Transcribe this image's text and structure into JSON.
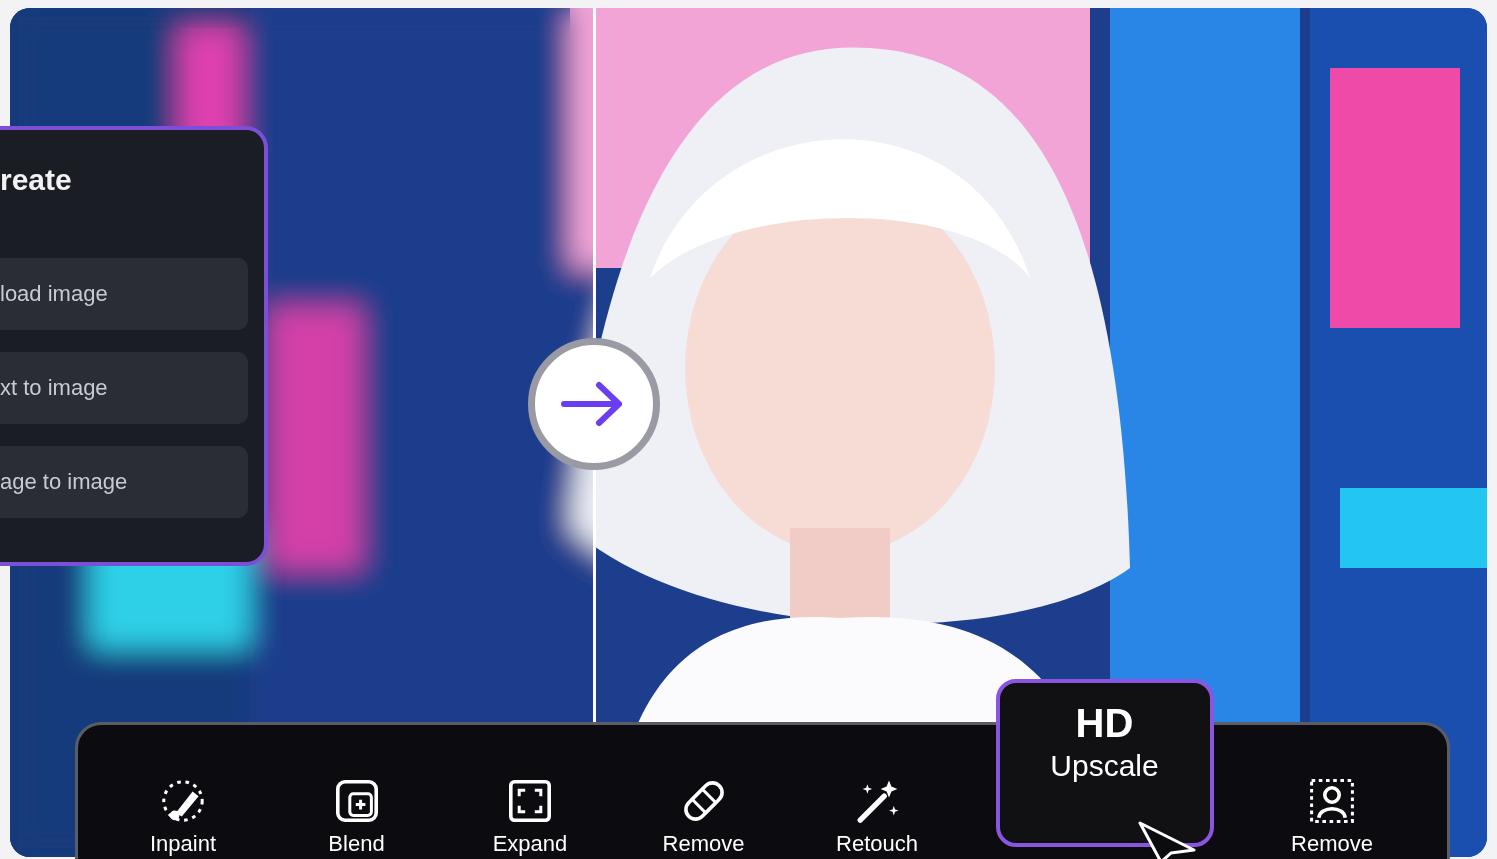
{
  "create_menu": {
    "title": "reate",
    "items": [
      {
        "label": "load image"
      },
      {
        "label": "xt to image"
      },
      {
        "label": "age to image"
      }
    ]
  },
  "tools": [
    {
      "label": "Inpaint",
      "selected": false
    },
    {
      "label": "Blend",
      "selected": false
    },
    {
      "label": "Expand",
      "selected": false
    },
    {
      "label": "Remove",
      "selected": false
    },
    {
      "label": "Retouch",
      "selected": false
    },
    {
      "badge": "HD",
      "label": "Upscale",
      "selected": true
    },
    {
      "label": "Remove",
      "selected": false
    }
  ]
}
